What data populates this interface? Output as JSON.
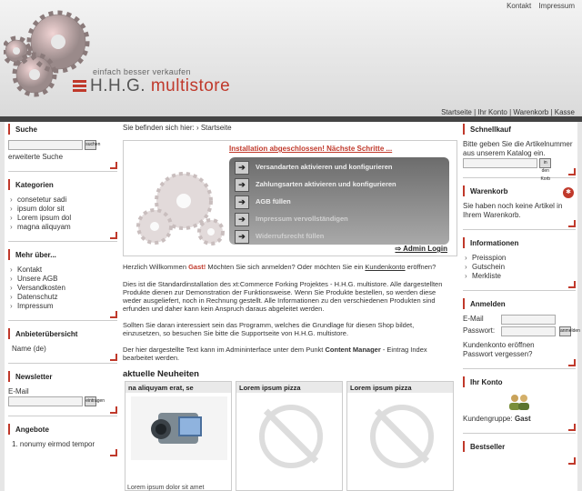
{
  "top_links": [
    "Kontakt",
    "Impressum"
  ],
  "brand": {
    "tagline": "einfach besser verkaufen",
    "name_a": "H.H.G.",
    "name_b": "multistore"
  },
  "nav_links": [
    "Startseite",
    "Ihr Konto",
    "Warenkorb",
    "Kasse"
  ],
  "left": {
    "suche": {
      "title": "Suche",
      "btn": "suchen",
      "link": "erweiterte Suche"
    },
    "kategorien": {
      "title": "Kategorien",
      "items": [
        "consetetur sadi",
        "ipsum dolor sit",
        "Lorem ipsum dol",
        "magna aliquyam"
      ]
    },
    "mehr": {
      "title": "Mehr über...",
      "items": [
        "Kontakt",
        "Unsere AGB",
        "Versandkosten",
        "Datenschutz",
        "Impressum"
      ]
    },
    "hersteller": {
      "title": "Anbieterübersicht",
      "value": "Name (de)"
    },
    "newsletter": {
      "title": "Newsletter",
      "label": "E-Mail",
      "btn": "eintragen"
    },
    "angebote": {
      "title": "Angebote",
      "item": "1.  nonumy eirmod tempor"
    }
  },
  "center": {
    "crumb_label": "Sie befinden sich hier:",
    "crumb_value": "Startseite",
    "install_head": "Installation abgeschlossen! Nächste Schritte ...",
    "steps": [
      "Versandarten aktivieren und konfigurieren",
      "Zahlungsarten aktivieren und konfigurieren",
      "AGB füllen",
      "Impressum vervollständigen",
      "Widerrufsrecht füllen"
    ],
    "admin_login": "Admin Login",
    "welcome_a": "Herzlich Willkommen ",
    "welcome_gast": "Gast!",
    "welcome_b": " Möchten Sie sich anmelden? Oder möchten Sie ein ",
    "welcome_link": "Kundenkonto",
    "welcome_c": " eröffnen?",
    "p1": "Dies ist die Standardinstallation des xt:Commerce Forking Projektes - H.H.G. multistore. Alle dargestellten Produkte dienen zur Demonstration der Funktionsweise. Wenn Sie Produkte bestellen, so werden diese weder ausgeliefert, noch in Rechnung gestellt. Alle Informationen zu den verschiedenen Produkten sind erfunden und daher kann kein Anspruch daraus abgeleitet werden.",
    "p2": "Sollten Sie daran interessiert sein das Programm, welches die Grundlage für diesen Shop bildet, einzusetzen, so besuchen Sie bitte die Supportseite von H.H.G. multistore.",
    "p3a": "Der hier dargestellte Text kann im Admininterface unter dem Punkt ",
    "p3b": "Content Manager",
    "p3c": " - Eintrag Index bearbeitet werden.",
    "neu_title": "aktuelle Neuheiten",
    "products": [
      {
        "name": "na aliquyam erat, se",
        "caption": "Lorem ipsum dolor sit amet"
      },
      {
        "name": "Lorem ipsum pizza"
      },
      {
        "name": "Lorem ipsum pizza"
      }
    ]
  },
  "right": {
    "schnell": {
      "title": "Schnellkauf",
      "text": "Bitte geben Sie die Artikelnummer aus unserem Katalog ein.",
      "btn": "in den Korb"
    },
    "warenkorb": {
      "title": "Warenkorb",
      "text": "Sie haben noch keine Artikel in Ihrem Warenkorb."
    },
    "info": {
      "title": "Informationen",
      "items": [
        "Preisspion",
        "Gutschein",
        "Merkliste"
      ]
    },
    "anmelden": {
      "title": "Anmelden",
      "email": "E-Mail",
      "pass": "Passwort:",
      "btn": "anmelden",
      "l1": "Kundenkonto eröffnen",
      "l2": "Passwort vergessen?"
    },
    "konto": {
      "title": "Ihr Konto",
      "group_label": "Kundengruppe: ",
      "group_value": "Gast"
    },
    "bestseller": {
      "title": "Bestseller"
    }
  }
}
